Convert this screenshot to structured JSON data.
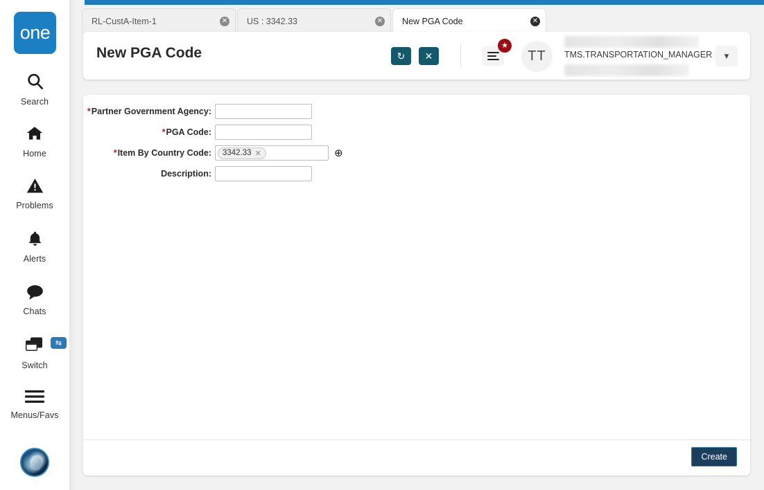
{
  "app": {
    "logo_text": "one",
    "accent_blue": "#1b7fc4",
    "accent_teal": "#14596b",
    "badge_red": "#a00b11",
    "create_navy": "#1d3d5c"
  },
  "sidebar": {
    "items": [
      {
        "label": "Search",
        "icon": "search-icon"
      },
      {
        "label": "Home",
        "icon": "home-icon"
      },
      {
        "label": "Problems",
        "icon": "warning-triangle-icon"
      },
      {
        "label": "Alerts",
        "icon": "bell-icon"
      },
      {
        "label": "Chats",
        "icon": "chat-bubble-icon"
      },
      {
        "label": "Switch",
        "icon": "windows-stack-icon"
      },
      {
        "label": "Menus/Favs",
        "icon": "hamburger-icon"
      }
    ],
    "switch_badge_icon": "swap-arrows-icon",
    "profile_avatar": "user-avatar-image"
  },
  "tabs": [
    {
      "label": "RL-CustA-Item-1",
      "active": false
    },
    {
      "label": "US : 3342.33",
      "active": false
    },
    {
      "label": "New PGA Code",
      "active": true
    }
  ],
  "header": {
    "title": "New PGA Code",
    "refresh_icon": "refresh-icon",
    "close_icon": "close-icon",
    "menu_icon": "hamburger-menu-icon",
    "star_badge_icon": "star-icon",
    "avatar_initials": "TT",
    "user_name": "TMS.TRANSPORTATION_MANAGER",
    "caret_icon": "chevron-down-icon"
  },
  "form": {
    "fields": [
      {
        "label": "Partner Government Agency:",
        "required": true,
        "value": "",
        "placeholder": "",
        "type": "text"
      },
      {
        "label": "PGA Code:",
        "required": true,
        "value": "",
        "placeholder": "",
        "type": "text"
      },
      {
        "label": "Item By Country Code:",
        "required": true,
        "value": "",
        "placeholder": "",
        "type": "token",
        "token": "3342.33",
        "token_remove_icon": "remove-icon",
        "lookup_icon": "magnifier-plus-icon"
      },
      {
        "label": "Description:",
        "required": false,
        "value": "",
        "placeholder": "",
        "type": "text"
      }
    ]
  },
  "footer": {
    "create_label": "Create"
  }
}
